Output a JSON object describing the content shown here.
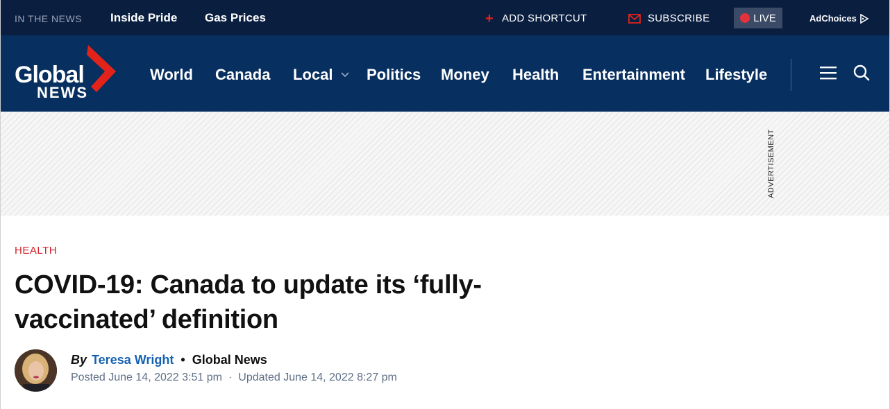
{
  "topbar": {
    "in_the_news": "IN THE NEWS",
    "trending": [
      "Inside Pride",
      "Gas Prices"
    ],
    "add_shortcut": "ADD SHORTCUT",
    "subscribe": "SUBSCRIBE",
    "live": "LIVE",
    "adchoices": "AdChoices"
  },
  "logo": {
    "word1": "Global",
    "word2": "NEWS"
  },
  "nav": {
    "items": [
      "World",
      "Canada",
      "Local",
      "Politics",
      "Money",
      "Health",
      "Entertainment",
      "Lifestyle"
    ]
  },
  "ad": {
    "label": "ADVERTISEMENT"
  },
  "article": {
    "category": "HEALTH",
    "headline_line1": "COVID-19: Canada to update its ‘fully-",
    "headline_line2": "vaccinated’ definition",
    "by": "By",
    "author": "Teresa Wright",
    "source": "Global News",
    "posted": "Posted June 14, 2022 3:51 pm",
    "updated": "Updated June 14, 2022 8:27 pm",
    "separator": "·",
    "byline_separator": "•"
  },
  "colors": {
    "topbar_bg": "#0a1e40",
    "nav_bg": "#072f5f",
    "accent_red": "#e2231a",
    "author_blue": "#1561b0"
  }
}
